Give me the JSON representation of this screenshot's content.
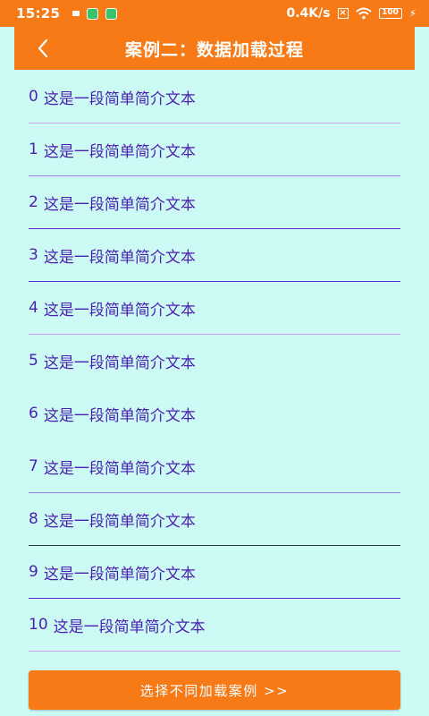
{
  "status_bar": {
    "time": "15:25",
    "speed": "0.4K/s",
    "battery": "100"
  },
  "toolbar": {
    "title": "案例二：数据加载过程",
    "back_icon": "chevron-left-icon"
  },
  "list": {
    "items": [
      {
        "index": "0",
        "text": "这是一段简单简介文本",
        "divider": "#c9a0e8"
      },
      {
        "index": "1",
        "text": "这是一段简单简介文本",
        "divider": "#a57be0"
      },
      {
        "index": "2",
        "text": "这是一段简单简介文本",
        "divider": "#5a2bd0"
      },
      {
        "index": "3",
        "text": "这是一段简单简介文本",
        "divider": "#5a2bd0"
      },
      {
        "index": "4",
        "text": "这是一段简单简介文本",
        "divider": "#c9a0e8"
      },
      {
        "index": "5",
        "text": "这是一段简单简介文本",
        "divider": "#ccfbf6"
      },
      {
        "index": "6",
        "text": "这是一段简单简介文本",
        "divider": "#ccfbf6"
      },
      {
        "index": "7",
        "text": "这是一段简单简介文本",
        "divider": "#a57be0"
      },
      {
        "index": "8",
        "text": "这是一段简单简介文本",
        "divider": "#1d3b3a"
      },
      {
        "index": "9",
        "text": "这是一段简单简介文本",
        "divider": "#5a2bd0"
      },
      {
        "index": "10",
        "text": "这是一段简单简介文本",
        "divider": "#c9a0e8"
      }
    ]
  },
  "cta": {
    "label": "选择不同加载案例 >>"
  },
  "colors": {
    "accent": "#f77a17",
    "background": "#ccfbf6",
    "item_text": "#4a1fb0"
  }
}
